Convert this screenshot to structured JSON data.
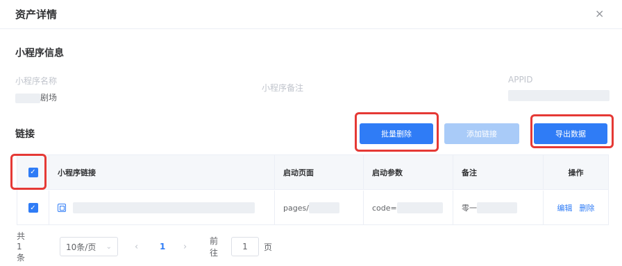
{
  "dialog": {
    "title": "资产详情",
    "close_label": "×"
  },
  "mini_program_info": {
    "section_title": "小程序信息",
    "name_label": "小程序名称",
    "name_value": "剧场",
    "remark_label": "小程序备注",
    "appid_label": "APPID"
  },
  "links": {
    "section_title": "链接",
    "buttons": {
      "batch_delete": "批量删除",
      "add_link": "添加链接",
      "export_data": "导出数据"
    },
    "columns": [
      "小程序链接",
      "启动页面",
      "启动参数",
      "备注",
      "操作"
    ],
    "rows": [
      {
        "checked": true,
        "start_page": "pages/",
        "start_params": "code=",
        "remark": "零一",
        "actions": [
          "编辑",
          "删除"
        ]
      }
    ]
  },
  "pagination": {
    "total_text": "共 1 条",
    "page_size": "10条/页",
    "current_page": "1",
    "goto_label": "前往",
    "goto_value": "1",
    "page_suffix": "页"
  },
  "colors": {
    "primary": "#2f7cf6",
    "disabled": "#a9cbf8",
    "highlight": "#e53935"
  },
  "icons": {
    "close": "close-icon",
    "copy": "copy-icon",
    "checkbox": "checkbox-checked-icon"
  }
}
